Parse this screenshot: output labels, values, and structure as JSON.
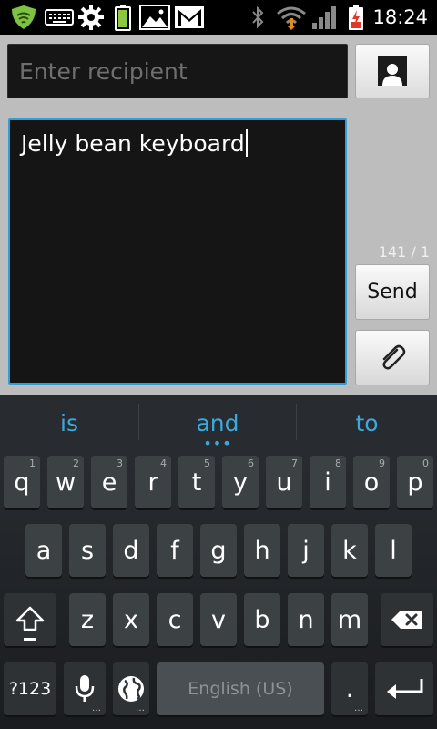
{
  "status_bar": {
    "time": "18:24",
    "icons": [
      "shield-icon",
      "keyboard-icon",
      "settings-gear-icon",
      "battery-icon",
      "gallery-icon",
      "gmail-icon",
      "bluetooth-icon",
      "wifi-icon",
      "signal-icon",
      "battery-charging-icon"
    ]
  },
  "compose": {
    "recipient_placeholder": "Enter recipient",
    "message_text": "Jelly bean keyboard",
    "counter": "141 / 1",
    "send_label": "Send"
  },
  "keyboard": {
    "suggestions": [
      "is",
      "and",
      "to"
    ],
    "row1": [
      {
        "key": "q",
        "hint": "1"
      },
      {
        "key": "w",
        "hint": "2"
      },
      {
        "key": "e",
        "hint": "3"
      },
      {
        "key": "r",
        "hint": "4"
      },
      {
        "key": "t",
        "hint": "5"
      },
      {
        "key": "y",
        "hint": "6"
      },
      {
        "key": "u",
        "hint": "7"
      },
      {
        "key": "i",
        "hint": "8"
      },
      {
        "key": "o",
        "hint": "9"
      },
      {
        "key": "p",
        "hint": "0"
      }
    ],
    "row2": [
      "a",
      "s",
      "d",
      "f",
      "g",
      "h",
      "j",
      "k",
      "l"
    ],
    "row3": [
      "z",
      "x",
      "c",
      "v",
      "b",
      "n",
      "m"
    ],
    "symbols_label": "?123",
    "space_label": "English (US)",
    "period_label": "."
  }
}
